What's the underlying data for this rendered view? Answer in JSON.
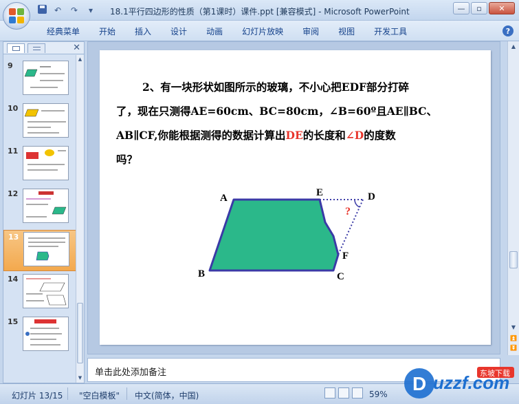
{
  "window": {
    "title": "18.1平行四边形的性质（第1课时）课件.ppt [兼容模式] - Microsoft PowerPoint"
  },
  "ribbon": {
    "tabs": [
      "经典菜单",
      "开始",
      "插入",
      "设计",
      "动画",
      "幻灯片放映",
      "审阅",
      "视图",
      "开发工具"
    ]
  },
  "slides_pane": {
    "thumbnails": [
      {
        "number": "9",
        "selected": false
      },
      {
        "number": "10",
        "selected": false
      },
      {
        "number": "11",
        "selected": false
      },
      {
        "number": "12",
        "selected": false
      },
      {
        "number": "13",
        "selected": true
      },
      {
        "number": "14",
        "selected": false
      },
      {
        "number": "15",
        "selected": false
      }
    ]
  },
  "slide": {
    "line1": "2、有一块形状如图所示的玻璃，不小心把EDF部分打碎",
    "line2": "了，现在只测得AE=60cm、BC=80cm，∠B=60º且AE∥BC、",
    "line3_a": "AB∥CF,你能根据测得的数据计算出",
    "line3_red1": "DE",
    "line3_b": "的长度和",
    "line3_red2": "∠D",
    "line3_c": "的度数",
    "line4": "吗？",
    "figure_labels": {
      "A": "A",
      "E": "E",
      "D": "D",
      "B": "B",
      "C": "C",
      "F": "F",
      "question": "?"
    },
    "colors": {
      "fill": "#2bb88a",
      "outline": "#3a3aa6",
      "red": "#e8362c"
    }
  },
  "notes": {
    "placeholder": "单击此处添加备注"
  },
  "status": {
    "slide_counter": "幻灯片 13/15",
    "theme": "\"空白模板\"",
    "language": "中文(简体，中国)",
    "zoom": "59%"
  },
  "watermark": {
    "brand": "uzzf.com",
    "tag": "东坡下载"
  }
}
